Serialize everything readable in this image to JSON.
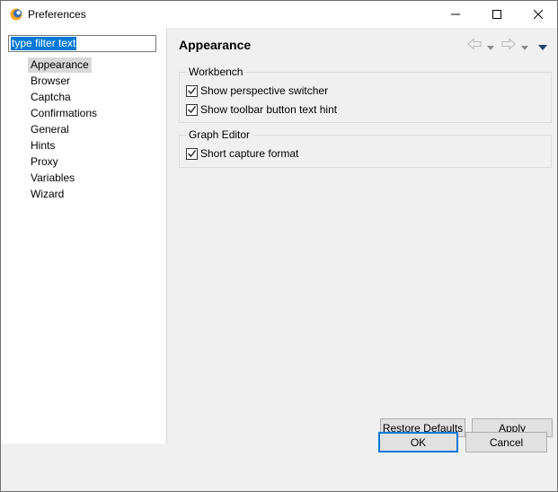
{
  "window": {
    "title": "Preferences",
    "app_icon": "eclipse-icon",
    "controls": [
      "minimize-icon",
      "maximize-icon",
      "close-icon"
    ]
  },
  "sidebar": {
    "filter_text": "type filter text",
    "items": [
      {
        "label": "Appearance",
        "selected": true
      },
      {
        "label": "Browser"
      },
      {
        "label": "Captcha"
      },
      {
        "label": "Confirmations"
      },
      {
        "label": "General"
      },
      {
        "label": "Hints"
      },
      {
        "label": "Proxy"
      },
      {
        "label": "Variables"
      },
      {
        "label": "Wizard"
      }
    ]
  },
  "page": {
    "title": "Appearance",
    "nav_icons": [
      "back-arrow-icon",
      "back-dropdown-icon",
      "forward-arrow-icon",
      "forward-dropdown-icon",
      "view-menu-icon"
    ],
    "groups": [
      {
        "label": "Workbench",
        "options": [
          {
            "label": "Show perspective switcher",
            "checked": true
          },
          {
            "label": "Show toolbar button text hint",
            "checked": true
          }
        ]
      },
      {
        "label": "Graph Editor",
        "options": [
          {
            "label": "Short capture format",
            "checked": true
          }
        ]
      }
    ],
    "restore_defaults": "Restore Defaults",
    "apply": "Apply"
  },
  "footer": {
    "ok": "OK",
    "cancel": "Cancel"
  },
  "colors": {
    "selection": "#0078d7",
    "background": "#f0f0f0"
  }
}
